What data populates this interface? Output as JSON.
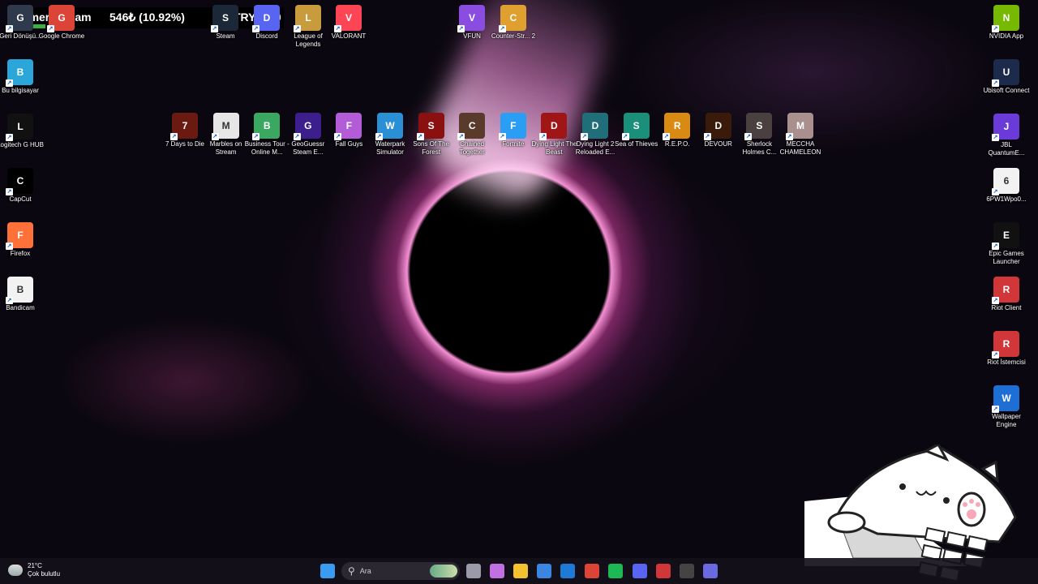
{
  "overlay": {
    "goal_label": "kamera alcam",
    "progress_text": "546₺ (10.92%)",
    "progress_value": 10.92,
    "goal_amount": "TRY5000"
  },
  "desktop_icons": {
    "top_row": [
      {
        "label": "Geri Dönüşü...",
        "icon": "recycle-bin-icon",
        "color": "#2f3b4c"
      },
      {
        "label": "Google Chrome",
        "icon": "chrome-icon",
        "color": "#db4437"
      },
      {
        "label": "Steam",
        "icon": "steam-icon",
        "color": "#1b2838"
      },
      {
        "label": "Discord",
        "icon": "discord-icon",
        "color": "#5865f2"
      },
      {
        "label": "League of Legends",
        "icon": "league-icon",
        "color": "#c89b3c"
      },
      {
        "label": "VALORANT",
        "icon": "valorant-icon",
        "color": "#fd4556"
      },
      {
        "label": "VFUN",
        "icon": "vfun-icon",
        "color": "#8a4de0"
      },
      {
        "label": "Counter-Str... 2",
        "icon": "counter-strike-icon",
        "color": "#e0a030"
      },
      {
        "label": "NVIDIA App",
        "icon": "nvidia-icon",
        "color": "#76b900"
      }
    ],
    "left_column": [
      {
        "label": "Bu bilgisayar",
        "icon": "computer-icon",
        "color": "#2aa7d8"
      },
      {
        "label": "Logitech G HUB",
        "icon": "logitech-icon",
        "color": "#111111"
      },
      {
        "label": "CapCut",
        "icon": "capcut-icon",
        "color": "#000000"
      },
      {
        "label": "Firefox",
        "icon": "firefox-icon",
        "color": "#ff7139"
      },
      {
        "label": "Bandicam",
        "icon": "file-icon",
        "color": "#f2f2f2"
      }
    ],
    "games_row": [
      {
        "label": "7 Days to Die",
        "icon": "seven-days-icon",
        "color": "#6b1a12"
      },
      {
        "label": "Marbles on Stream",
        "icon": "marbles-icon",
        "color": "#e6e6e6"
      },
      {
        "label": "Business Tour - Online M...",
        "icon": "business-tour-icon",
        "color": "#3aa860"
      },
      {
        "label": "GeoGuessr Steam E...",
        "icon": "geoguessr-icon",
        "color": "#3c1e8c"
      },
      {
        "label": "Fall Guys",
        "icon": "fall-guys-icon",
        "color": "#b45cd8"
      },
      {
        "label": "Waterpark Simulator",
        "icon": "waterpark-icon",
        "color": "#2b8fd6"
      },
      {
        "label": "Sons Of The Forest",
        "icon": "sons-forest-icon",
        "color": "#8b1010"
      },
      {
        "label": "Chained Together",
        "icon": "chained-together-icon",
        "color": "#5a3a2a"
      },
      {
        "label": "Fortnite",
        "icon": "fortnite-icon",
        "color": "#2a9df4"
      },
      {
        "label": "Dying Light The Beast",
        "icon": "dying-light-beast-icon",
        "color": "#a01515"
      },
      {
        "label": "Dying Light 2 Reloaded E...",
        "icon": "dying-light-2-icon",
        "color": "#1f6e7a"
      },
      {
        "label": "Sea of Thieves",
        "icon": "sea-of-thieves-icon",
        "color": "#1a8f7a"
      },
      {
        "label": "R.E.P.O.",
        "icon": "repo-icon",
        "color": "#d88a12"
      },
      {
        "label": "DEVOUR",
        "icon": "devour-icon",
        "color": "#3a1a0a"
      },
      {
        "label": "Sherlock Holmes C...",
        "icon": "sherlock-icon",
        "color": "#4a4040"
      },
      {
        "label": "MECCHA CHAMELEON",
        "icon": "chameleon-icon",
        "color": "#aa8f8f"
      }
    ],
    "right_column": [
      {
        "label": "Ubisoft Connect",
        "icon": "ubisoft-icon",
        "color": "#1c2b4c"
      },
      {
        "label": "JBL QuantumE...",
        "icon": "jbl-icon",
        "color": "#6a3bd8"
      },
      {
        "label": "6PW1Wpo0...",
        "icon": "chrome-file-icon",
        "color": "#f2f2f2"
      },
      {
        "label": "Epic Games Launcher",
        "icon": "epic-games-icon",
        "color": "#111111"
      },
      {
        "label": "Riot Client",
        "icon": "riot-client-icon",
        "color": "#d13639"
      },
      {
        "label": "Riot İstemcisi",
        "icon": "riot-istemcisi-icon",
        "color": "#d13639"
      },
      {
        "label": "Wallpaper Engine",
        "icon": "wallpaper-engine-icon",
        "color": "#1d6fd6"
      }
    ]
  },
  "taskbar": {
    "weather_temp": "21°C",
    "weather_desc": "Çok bulutlu",
    "search_placeholder": "Ara",
    "apps": [
      {
        "name": "start-button",
        "icon": "windows-icon",
        "color": "#3a9cf0"
      },
      {
        "name": "task-view-button",
        "icon": "task-view-icon",
        "color": "#9a9aa8"
      },
      {
        "name": "copilot-button",
        "icon": "copilot-icon",
        "color": "#c070e0"
      },
      {
        "name": "file-explorer-button",
        "icon": "folder-icon",
        "color": "#f2c230"
      },
      {
        "name": "store-button",
        "icon": "store-icon",
        "color": "#3a86e0"
      },
      {
        "name": "outlook-button",
        "icon": "mail-icon",
        "color": "#1e7ad6"
      },
      {
        "name": "chrome-taskbar-button",
        "icon": "chrome-icon",
        "color": "#db4437"
      },
      {
        "name": "spotify-button",
        "icon": "spotify-icon",
        "color": "#1db954"
      },
      {
        "name": "discord-taskbar-button",
        "icon": "discord-icon",
        "color": "#5865f2"
      },
      {
        "name": "riot-taskbar-button",
        "icon": "riot-icon",
        "color": "#d13639"
      },
      {
        "name": "obs-button",
        "icon": "obs-icon",
        "color": "#444444"
      },
      {
        "name": "app-taskbar-button",
        "icon": "app-icon",
        "color": "#6a6ae0"
      }
    ]
  }
}
